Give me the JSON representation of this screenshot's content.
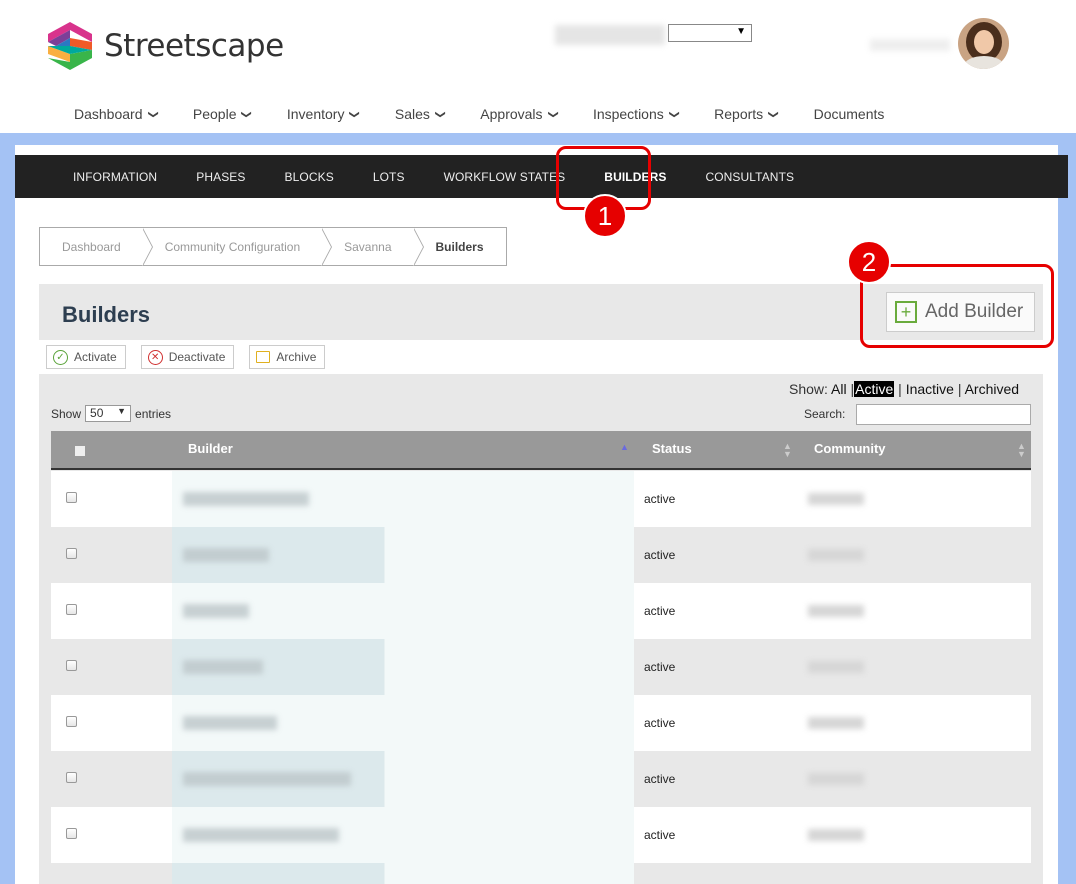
{
  "app": {
    "name": "Streetscape"
  },
  "header": {
    "community_select_value": "",
    "user_name": ""
  },
  "topnav": [
    {
      "label": "Dashboard",
      "dropdown": true
    },
    {
      "label": "People",
      "dropdown": true
    },
    {
      "label": "Inventory",
      "dropdown": true
    },
    {
      "label": "Sales",
      "dropdown": true
    },
    {
      "label": "Approvals",
      "dropdown": true
    },
    {
      "label": "Inspections",
      "dropdown": true
    },
    {
      "label": "Reports",
      "dropdown": true
    },
    {
      "label": "Documents",
      "dropdown": false
    }
  ],
  "subnav": [
    "INFORMATION",
    "PHASES",
    "BLOCKS",
    "LOTS",
    "WORKFLOW STATES",
    "BUILDERS",
    "CONSULTANTS"
  ],
  "subnav_active": "BUILDERS",
  "breadcrumb": [
    "Dashboard",
    "Community Configuration",
    "Savanna",
    "Builders"
  ],
  "page": {
    "title": "Builders",
    "add_button": "Add Builder"
  },
  "actions": {
    "activate": "Activate",
    "deactivate": "Deactivate",
    "archive": "Archive"
  },
  "filter": {
    "show_label": "Show:",
    "all": "All",
    "active": "Active",
    "inactive": "Inactive",
    "archived": "Archived",
    "sep": "|"
  },
  "entries": {
    "show": "Show",
    "value": "50",
    "suffix": "entries"
  },
  "search": {
    "label": "Search:"
  },
  "table": {
    "headers": {
      "builder": "Builder",
      "status": "Status",
      "community": "Community"
    },
    "rows": [
      {
        "status": "active"
      },
      {
        "status": "active"
      },
      {
        "status": "active"
      },
      {
        "status": "active"
      },
      {
        "status": "active"
      },
      {
        "status": "active"
      },
      {
        "status": "active"
      }
    ]
  },
  "callouts": {
    "one": "1",
    "two": "2"
  },
  "colors": {
    "accent_red": "#e60000",
    "blue_bg": "#a4c2f4",
    "subnav_bg": "#222222",
    "plus_green": "#6aab3d"
  }
}
